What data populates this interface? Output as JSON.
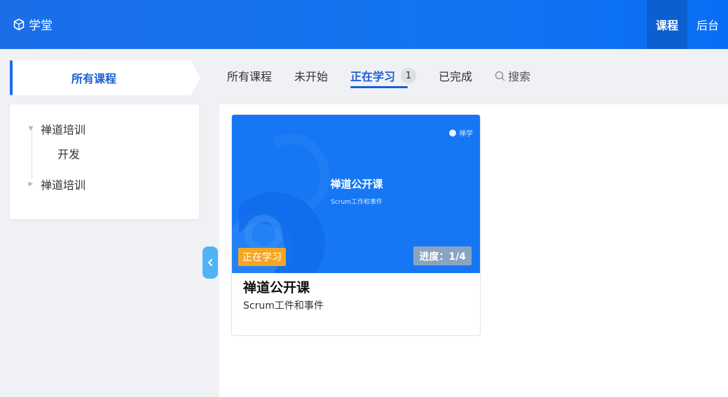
{
  "app": {
    "brand": "学堂",
    "icon": "cube-icon"
  },
  "topnav": [
    {
      "label": "课程",
      "active": true
    },
    {
      "label": "后台",
      "active": false
    }
  ],
  "sidebar": {
    "tab_label": "所有课程",
    "tree": [
      {
        "label": "禅道培训",
        "expanded": true,
        "icon": "caret-down-icon"
      },
      {
        "label": "开发",
        "child": true
      },
      {
        "label": "禅道培训",
        "expanded": false,
        "icon": "caret-right-icon"
      }
    ],
    "collapse_icon": "chevron-left-icon"
  },
  "tabs": [
    {
      "label": "所有课程"
    },
    {
      "label": "未开始"
    },
    {
      "label": "正在学习",
      "active": true,
      "count": "1"
    },
    {
      "label": "已完成"
    },
    {
      "label": "搜索",
      "icon": "search-icon"
    }
  ],
  "courses": [
    {
      "cover_title": "禅道公开课",
      "cover_subtitle": "Scrum工作和事件",
      "cover_brand": "禅学",
      "status": "正在学习",
      "progress": "进度：1/4",
      "title": "禅道公开课",
      "subtitle": "Scrum工件和事件"
    }
  ],
  "colors": {
    "header": "#1a6ee8",
    "accent": "#1a5fd6",
    "status_badge": "#f5a623",
    "cover": "#1677f5"
  }
}
